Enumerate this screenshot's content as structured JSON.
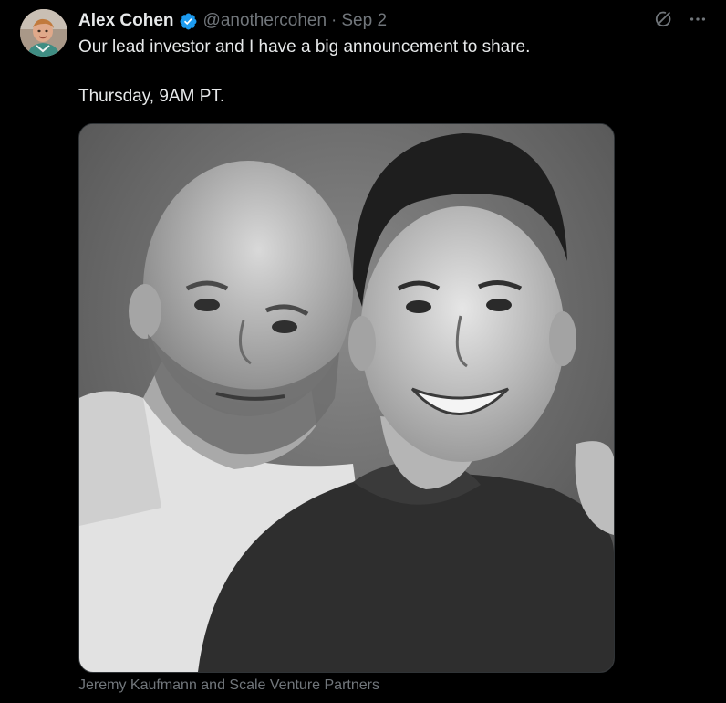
{
  "tweet": {
    "author": {
      "display_name": "Alex Cohen",
      "handle": "@anothercohen",
      "verified_icon": "verified-badge-icon",
      "avatar": "avatar-photo"
    },
    "separator": "·",
    "date": "Sep 2",
    "text_line_1": "Our lead investor and I have a big announcement to share.",
    "text_line_2": "Thursday, 9AM PT.",
    "media": {
      "type": "photo",
      "caption": "Jeremy Kaufmann and Scale Venture Partners"
    },
    "actions": {
      "grok_icon": "grok-icon",
      "more_icon": "more-icon"
    }
  },
  "colors": {
    "background": "#000000",
    "text_primary": "#e7e9ea",
    "text_secondary": "#71767b",
    "verified_blue": "#1d9bf0",
    "border": "#2f3336"
  }
}
